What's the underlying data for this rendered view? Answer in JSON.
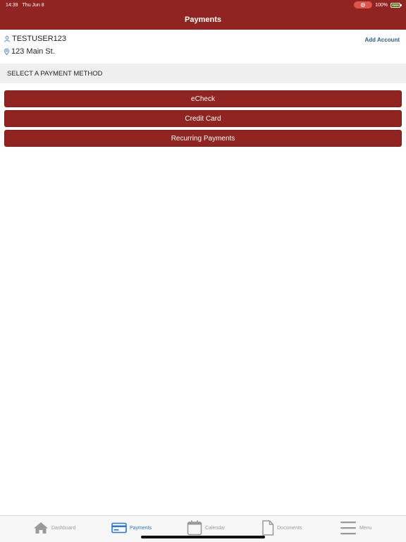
{
  "status_bar": {
    "time": "14:39",
    "date": "Thu Jun 8",
    "battery": "100%"
  },
  "nav": {
    "title": "Payments"
  },
  "account": {
    "username": "TESTUSER123",
    "address": "123 Main St.",
    "add_account_label": "Add Account"
  },
  "section": {
    "title": "SELECT A PAYMENT METHOD"
  },
  "payment_methods": [
    "eCheck",
    "Credit Card",
    "Recurring Payments"
  ],
  "tabs": [
    {
      "label": "Dashboard",
      "icon": "home-icon"
    },
    {
      "label": "Payments",
      "icon": "credit-card-icon"
    },
    {
      "label": "Calendar",
      "icon": "calendar-icon"
    },
    {
      "label": "Documents",
      "icon": "document-icon"
    },
    {
      "label": "Menu",
      "icon": "menu-icon"
    }
  ],
  "active_tab": "Payments",
  "colors": {
    "brand": "#8f2420",
    "link": "#2a5d83",
    "active_tab": "#2a75cf",
    "inactive_tab": "#9a9a9a"
  }
}
